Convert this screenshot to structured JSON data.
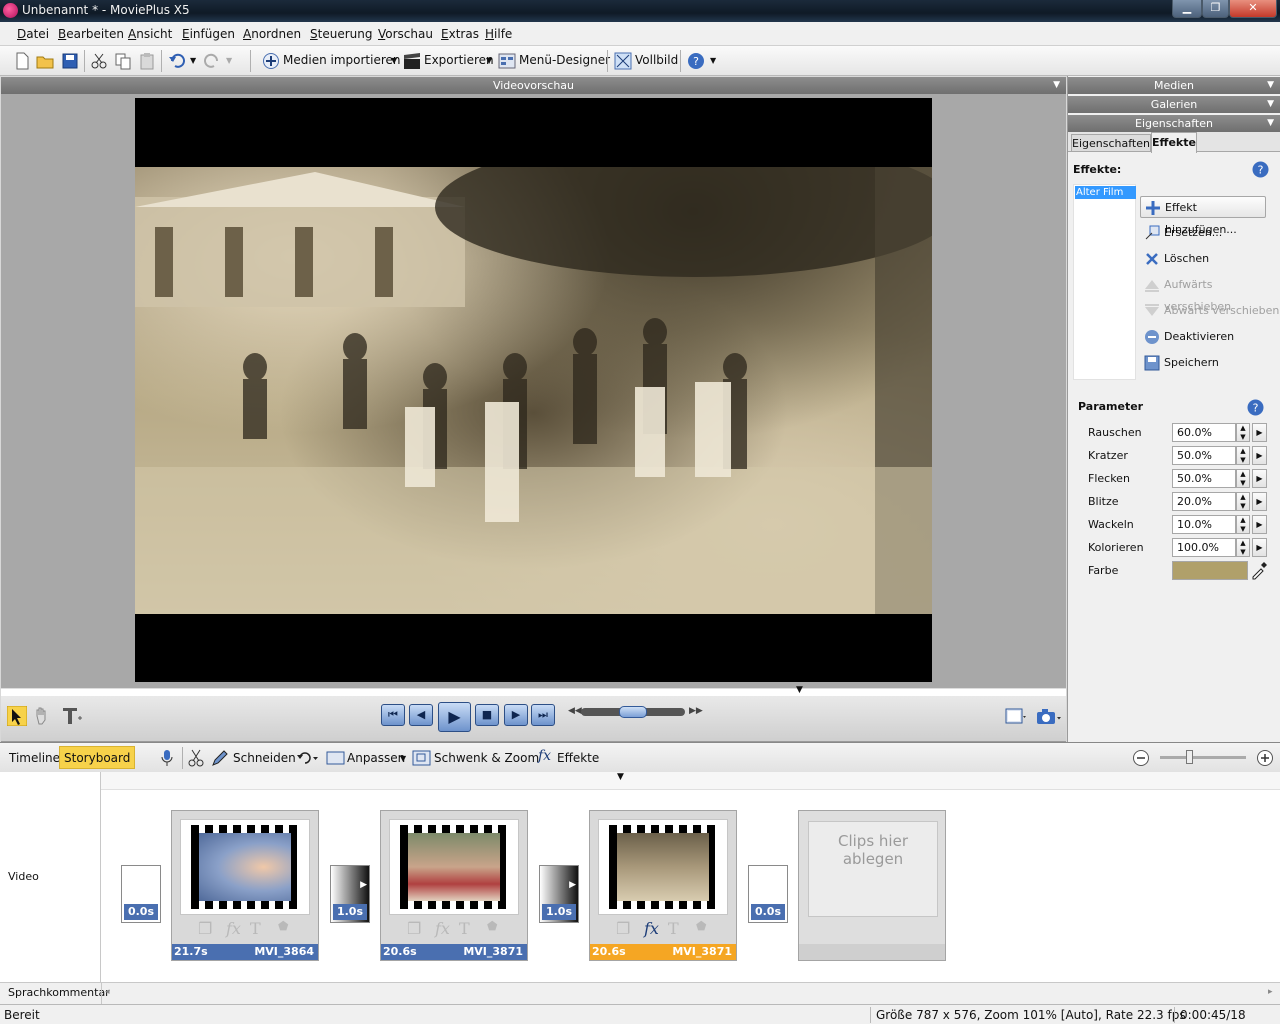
{
  "window": {
    "title": "Unbenannt * - MoviePlus X5",
    "min": "▁",
    "max": "❐",
    "close": "✕"
  },
  "menu": [
    "Datei",
    "Bearbeiten",
    "Ansicht",
    "Einfügen",
    "Anordnen",
    "Steuerung",
    "Vorschau",
    "Extras",
    "Hilfe"
  ],
  "toolbar": {
    "import_label": "Medien importieren",
    "export_label": "Exportieren",
    "menu_designer_label": "Menü-Designer",
    "fullscreen_label": "Vollbild"
  },
  "preview": {
    "header": "Videovorschau"
  },
  "right_panel": {
    "headers": [
      "Medien",
      "Galerien",
      "Eigenschaften"
    ],
    "tabs": [
      "Eigenschaften",
      "Effekte"
    ],
    "effects_title": "Effekte:",
    "effects_list": [
      "Alter Film"
    ],
    "buttons": {
      "add": "Effekt hinzufügen...",
      "replace": "Ersetzen...",
      "delete": "Löschen",
      "move_up": "Aufwärts verschieben",
      "move_down": "Abwärts verschieben",
      "deactivate": "Deaktivieren",
      "save": "Speichern"
    },
    "parameter_title": "Parameter",
    "parameters": [
      {
        "name": "Rauschen",
        "value": "60.0%"
      },
      {
        "name": "Kratzer",
        "value": "50.0%"
      },
      {
        "name": "Flecken",
        "value": "50.0%"
      },
      {
        "name": "Blitze",
        "value": "20.0%"
      },
      {
        "name": "Wackeln",
        "value": "10.0%"
      },
      {
        "name": "Kolorieren",
        "value": "100.0%"
      }
    ],
    "color_label": "Farbe",
    "color_value": "#b0a06a"
  },
  "timeline_toolbar": {
    "timeline_tab": "Timeline",
    "storyboard_tab": "Storyboard",
    "cut": "Schneiden",
    "fit": "Anpassen",
    "pan_zoom": "Schwenk & Zoom",
    "effects": "Effekte"
  },
  "storyboard": {
    "track_label": "Video",
    "speech_label": "Sprachkommentar",
    "transitions": [
      "0.0s",
      "1.0s",
      "1.0s",
      "0.0s"
    ],
    "clips": [
      {
        "duration": "21.7s",
        "name": "MVI_3864",
        "selected": false
      },
      {
        "duration": "20.6s",
        "name": "MVI_3871",
        "selected": false
      },
      {
        "duration": "20.6s",
        "name": "MVI_3871",
        "selected": true
      }
    ],
    "drop_hint_line1": "Clips hier",
    "drop_hint_line2": "ablegen"
  },
  "status": {
    "ready": "Bereit",
    "info": "Größe 787 x 576, Zoom 101% [Auto], Rate 22.3 fps",
    "time": "0:00:45/18"
  }
}
